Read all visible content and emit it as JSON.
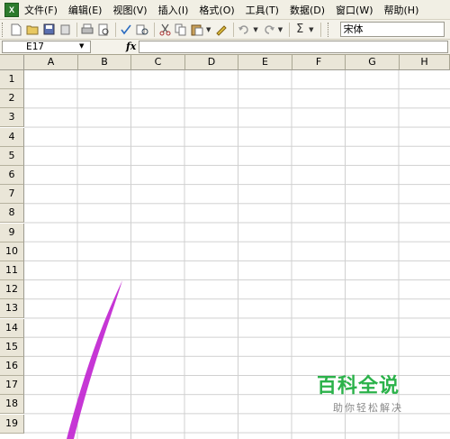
{
  "menu": {
    "items": [
      "文件(F)",
      "编辑(E)",
      "视图(V)",
      "插入(I)",
      "格式(O)",
      "工具(T)",
      "数据(D)",
      "窗口(W)",
      "帮助(H)"
    ]
  },
  "toolbar": {
    "icons": [
      "new-icon",
      "open-icon",
      "save-icon",
      "permission-icon",
      "print-icon",
      "print-preview-icon",
      "spelling-icon",
      "research-icon",
      "cut-icon",
      "copy-icon",
      "paste-icon",
      "format-painter-icon",
      "undo-icon",
      "redo-icon",
      "autosum-icon"
    ],
    "autosum_glyph": "Σ",
    "font_name": "宋体"
  },
  "formula_bar": {
    "name_box": "E17",
    "fx_label": "fx",
    "formula": ""
  },
  "sheet": {
    "columns": [
      "A",
      "B",
      "C",
      "D",
      "E",
      "F",
      "G",
      "H"
    ],
    "rows": [
      "1",
      "2",
      "3",
      "4",
      "5",
      "6",
      "7",
      "8",
      "9",
      "10",
      "11",
      "12",
      "13",
      "14",
      "15",
      "16",
      "17",
      "18",
      "19"
    ],
    "selected_cell": "E17"
  },
  "watermark": {
    "title": "百科全说",
    "subtitle": "助你轻松解决"
  },
  "colors": {
    "watermark_green": "#2bb24a",
    "stroke_magenta": "#c020d0",
    "menubar_bg": "#f1efe4",
    "header_bg": "#eae6d8",
    "gridline": "#d0d0d0"
  }
}
